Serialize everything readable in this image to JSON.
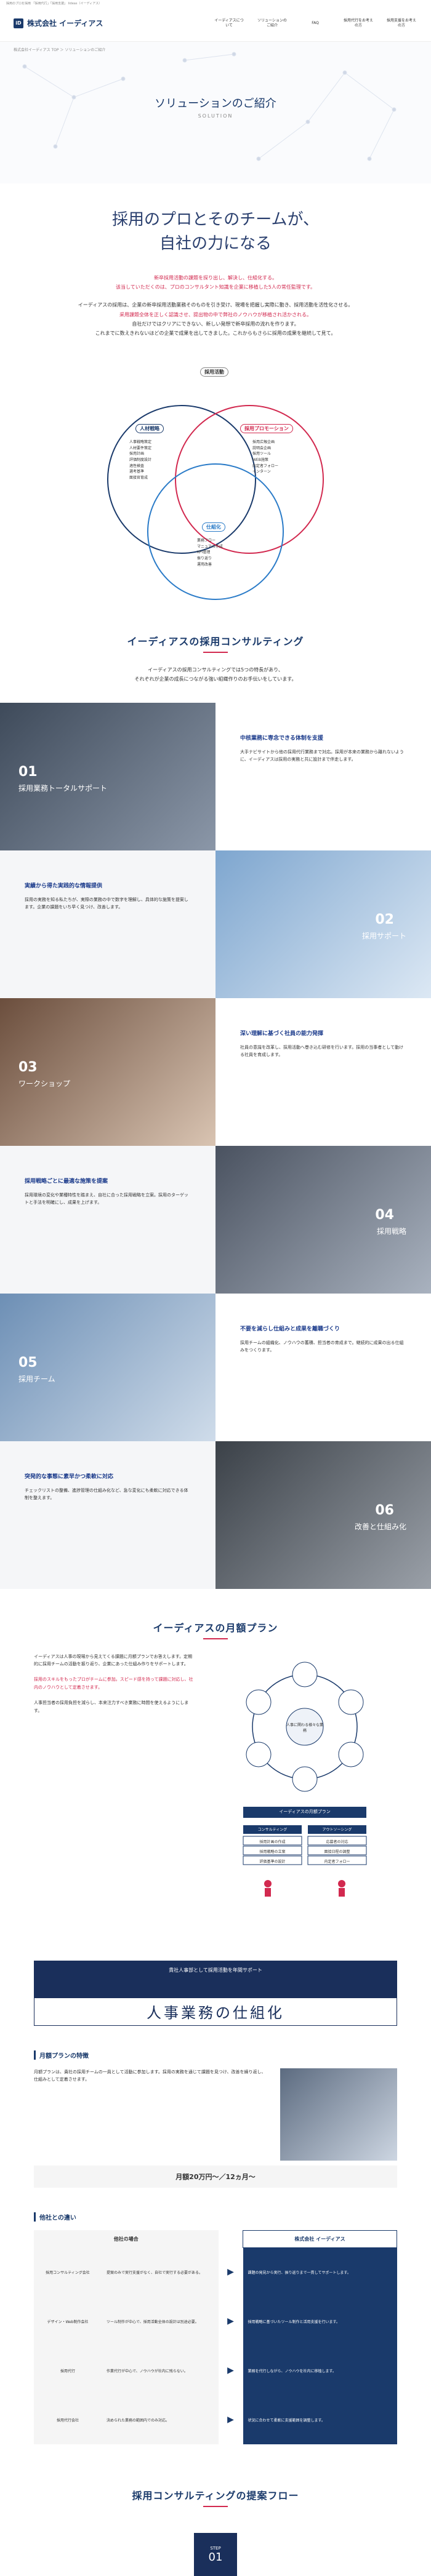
{
  "topbar": "採用のプロを採用 「採用代行」「採用支援」 Iideas（イーディアス）",
  "logo": {
    "mark": "iD",
    "text": "株式会社 イーディアス"
  },
  "nav": [
    "イーディアスについて",
    "ソリューションのご紹介",
    "FAQ",
    "採用代行をお考えの方",
    "採用支援をお考えの方"
  ],
  "breadcrumb": "株式会社イーディアス TOP ＞ ソリューションのご紹介",
  "hero": {
    "title": "ソリューションのご紹介",
    "sub": "SOLUTION"
  },
  "catch": [
    "採用のプロとそのチームが、",
    "自社の力になる"
  ],
  "intro": {
    "lead1": "新卒採用活動の課題を探り出し、解決し、仕組化する。",
    "lead2": "该当していただくのは、プロのコンサルタント知識を企業に移植した5人の常任監理です。",
    "p1": "イーディアスの採用は、企業の新卒採用活動業務そのものを引き受け、現場を把握し実際に動き、採用活動を活性化させる。",
    "p2": "采用課題全体を正しく認識させ、提出物の中で弊社のノウハウが移植され活かされる。",
    "p3": "自社だけではクリアにできない、新しい発想で新卒採用の流れを作ります。",
    "p4": "これまでに数えきれないほどの企業で成果を出してきました。これからもさらに採用の成果を継続して見て。"
  },
  "venn": {
    "top": "採用活動",
    "left": "人材戦略",
    "right": "採用プロモーション",
    "bottom": "仕組化",
    "left_items": [
      "人事戦略策定",
      "人材要件策定",
      "採用計画",
      "評価制度設計",
      "適性検査",
      "選考基準",
      "面接官育成"
    ],
    "right_items": [
      "採用広報企画",
      "説明会企画",
      "採用ツール",
      "WEB施策",
      "内定者フォロー",
      "インターン"
    ],
    "bottom_items": [
      "業務フロー",
      "マニュアル作成",
      "KPI管理",
      "振り返り",
      "運用改善"
    ]
  },
  "consult": {
    "title": "イーディアスの採用コンサルティング",
    "desc": [
      "イーディアスの採用コンサルティングでは5つの特長があり、",
      "それぞれが企業の成長につながる強い組織作りのお手伝いをしています。"
    ]
  },
  "features": [
    {
      "num": "01",
      "cap": "採用業務トータルサポート",
      "h": "中核業務に専念できる体制を支援",
      "t": "大手ナビサイトから他の採用代行業務まで対応。採用が本来の業務から離れないように、イーディアスは採用の実務と共に設計まで伴走します。"
    },
    {
      "num": "02",
      "cap": "採用サポート",
      "h": "実績から得た実践的な情報提供",
      "t": "採用の実務を知る私たちが、実際の業務の中で数字を理解し、具体的な施策を提案します。企業の課題をいち早く見つけ、改善します。"
    },
    {
      "num": "03",
      "cap": "ワークショップ",
      "h": "深い理解に基づく社員の能力発揮",
      "t": "社員の意識を改革し、採用活動へ巻き込む研修を行います。採用の当事者として動ける社員を育成します。"
    },
    {
      "num": "04",
      "cap": "採用戦略",
      "h": "採用戦略ごとに最適な施策を提案",
      "t": "採用環境の変化や業種特性を踏まえ、自社に合った採用戦略を立案。採用のターゲットと手法を明確にし、成果を上げます。"
    },
    {
      "num": "05",
      "cap": "採用チーム",
      "h": "不要を減らし仕組みと成果を離職づくり",
      "t": "採用チームの組織化、ノウハウの蓄積、担当者の育成まで。継続的に成果の出る仕組みをつくります。"
    },
    {
      "num": "06",
      "cap": "改善と仕組み化",
      "h": "突発的な事態に素早かつ柔軟に対応",
      "t": "チェックリストの整備、進捗管理の仕組み化など、急な変化にも柔軟に対応できる体制を整えます。"
    }
  ],
  "plan": {
    "title": "イーディアスの月額プラン",
    "p1": "イーディアスは人事の現場から見えてくる課題に月額プランでお答えします。定期的に採用チームの活動を振り返り、企業にあった仕組み作りをサポートします。",
    "p2": "採用のスキルをもったプロがチームに参加。スピード感を持って課題に対応し、社内のノウハウとして定着させます。",
    "p3": "人事担当者の採用負担を減らし、本来注力すべき業務に時間を使えるようにします。",
    "diagram_center": "人事に関わる様々な業務",
    "diagram_label": "イーディアスの月額プラン",
    "c1": "コンサルティング",
    "c2": "アウトソーシング",
    "c1_items": [
      "採用計画の作成",
      "採用戦略の立案",
      "評価基準の設計"
    ],
    "c2_items": [
      "応募者の対応",
      "面接日程の調整",
      "内定者フォロー"
    ]
  },
  "band": {
    "small": "貴社人事部として採用活動を年間サポート",
    "big": "人事業務の仕組化"
  },
  "features2": {
    "h": "月額プランの特徴",
    "t": "月額プランは、貴社の採用チームの一員として活動に参加します。採用の実務を通じて課題を見つけ、改善を繰り返し、仕組みとして定着させます。",
    "price": "月額20万円〜／12ヵ月〜"
  },
  "diff": {
    "h": "他社との違い",
    "colA": "他社の場合",
    "colB": "株式会社 イーディアス",
    "rows": [
      {
        "k": "採用コンサルティング会社",
        "a": "提案のみで実行支援がなく、自社で実行する必要がある。",
        "b": "課題の発見から実行、振り返りまで一貫してサポートします。"
      },
      {
        "k": "デザイン・Web制作会社",
        "a": "ツール制作が中心で、採用活動全体の設計は別途必要。",
        "b": "採用戦略に基づいたツール制作と活用支援を行います。"
      },
      {
        "k": "採用代行",
        "a": "作業代行が中心で、ノウハウが社内に残らない。",
        "b": "業務を代行しながら、ノウハウを社内に移植します。"
      },
      {
        "k": "採用代行会社",
        "a": "決められた業務の範囲内でのみ対応。",
        "b": "状況に合わせて柔軟に支援範囲を調整します。"
      }
    ]
  },
  "flow": {
    "title": "採用コンサルティングの提案フロー",
    "step": "STEP",
    "num": "01"
  },
  "colors": {
    "navy": "#1a3a6b",
    "red": "#d2294f",
    "blue": "#2a7bc8"
  }
}
